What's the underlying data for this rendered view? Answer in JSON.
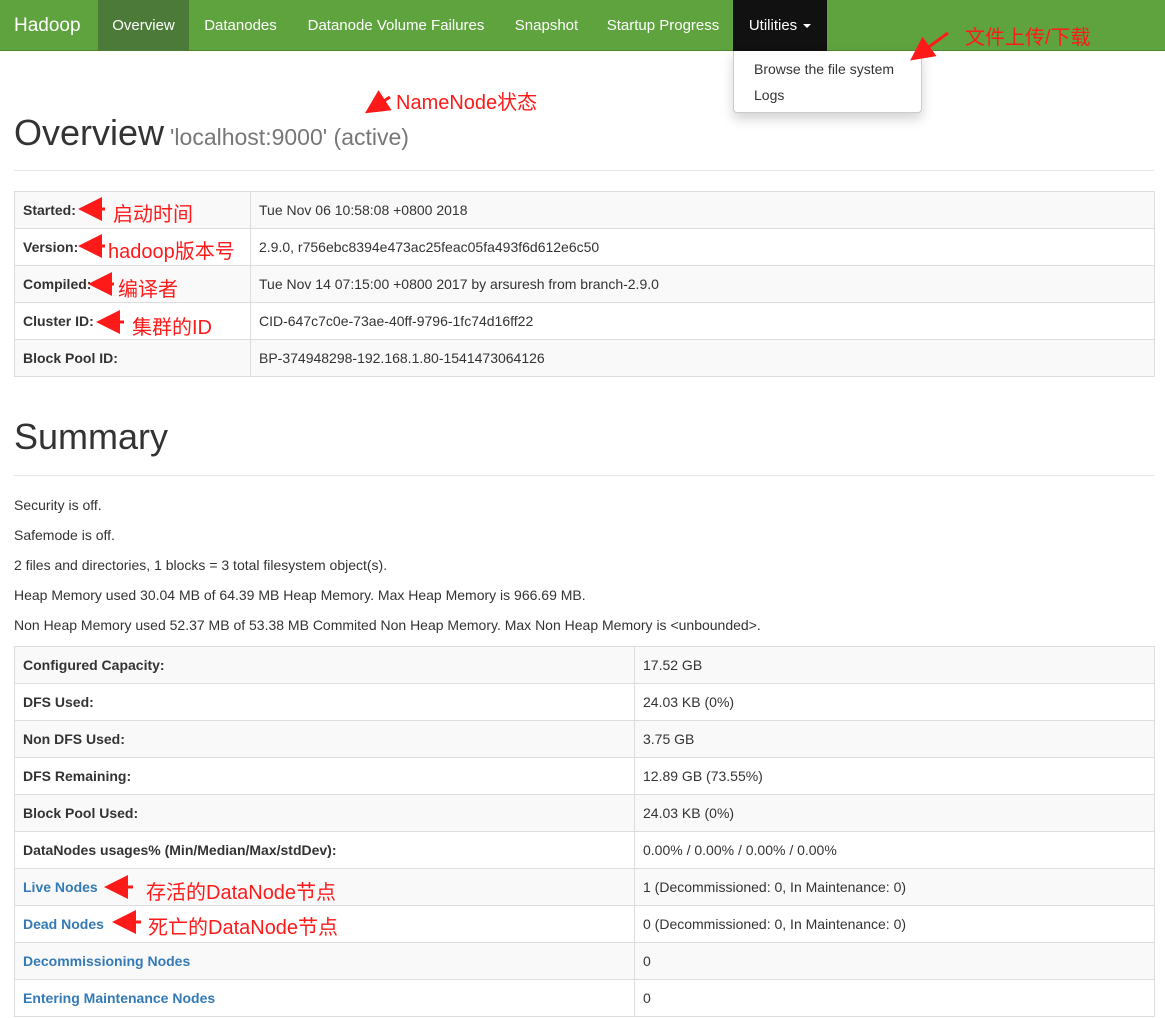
{
  "nav": {
    "brand": "Hadoop",
    "tabs": [
      "Overview",
      "Datanodes",
      "Datanode Volume Failures",
      "Snapshot",
      "Startup Progress"
    ],
    "utilities": "Utilities",
    "dropdown": [
      "Browse the file system",
      "Logs"
    ]
  },
  "overview": {
    "title": "Overview",
    "subtitle": "'localhost:9000' (active)",
    "rows": [
      {
        "label": "Started:",
        "value": "Tue Nov 06 10:58:08 +0800 2018"
      },
      {
        "label": "Version:",
        "value": "2.9.0, r756ebc8394e473ac25feac05fa493f6d612e6c50"
      },
      {
        "label": "Compiled:",
        "value": "Tue Nov 14 07:15:00 +0800 2017 by arsuresh from branch-2.9.0"
      },
      {
        "label": "Cluster ID:",
        "value": "CID-647c7c0e-73ae-40ff-9796-1fc74d16ff22"
      },
      {
        "label": "Block Pool ID:",
        "value": "BP-374948298-192.168.1.80-1541473064126"
      }
    ]
  },
  "summary": {
    "title": "Summary",
    "lines": [
      "Security is off.",
      "Safemode is off.",
      "2 files and directories, 1 blocks = 3 total filesystem object(s).",
      "Heap Memory used 30.04 MB of 64.39 MB Heap Memory. Max Heap Memory is 966.69 MB.",
      "Non Heap Memory used 52.37 MB of 53.38 MB Commited Non Heap Memory. Max Non Heap Memory is <unbounded>."
    ],
    "rows": [
      {
        "label": "Configured Capacity:",
        "value": "17.52 GB"
      },
      {
        "label": "DFS Used:",
        "value": "24.03 KB (0%)"
      },
      {
        "label": "Non DFS Used:",
        "value": "3.75 GB"
      },
      {
        "label": "DFS Remaining:",
        "value": "12.89 GB (73.55%)"
      },
      {
        "label": "Block Pool Used:",
        "value": "24.03 KB (0%)"
      },
      {
        "label": "DataNodes usages% (Min/Median/Max/stdDev):",
        "value": "0.00% / 0.00% / 0.00% / 0.00%"
      },
      {
        "label": "Live Nodes",
        "value": "1 (Decommissioned: 0, In Maintenance: 0)"
      },
      {
        "label": "Dead Nodes",
        "value": "0 (Decommissioned: 0, In Maintenance: 0)"
      },
      {
        "label": "Decommissioning Nodes",
        "value": "0"
      },
      {
        "label": "Entering Maintenance Nodes",
        "value": "0"
      }
    ]
  },
  "annotations": {
    "upload": "文件上传/下载",
    "namenode": "NameNode状态",
    "started": "启动时间",
    "version": "hadoop版本号",
    "compiled": "编译者",
    "cluster": "集群的ID",
    "live": "存活的DataNode节点",
    "dead": "死亡的DataNode节点"
  },
  "colors": {
    "navbar": "#5fa33e",
    "annotation": "#ff1a1a",
    "link": "#337ab7"
  }
}
